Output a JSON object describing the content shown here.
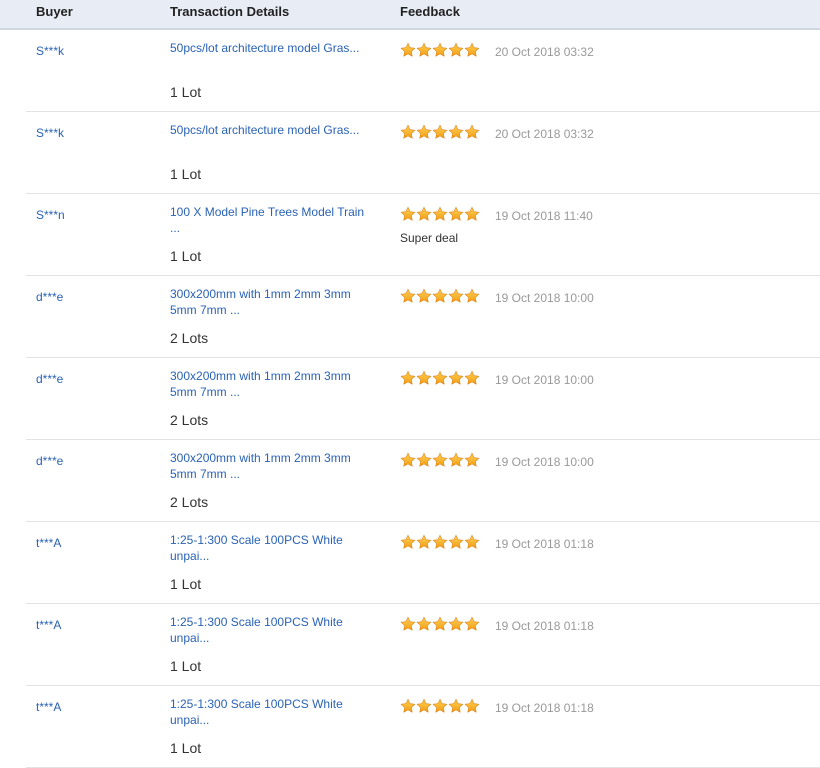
{
  "header": {
    "buyer": "Buyer",
    "transaction": "Transaction Details",
    "feedback": "Feedback"
  },
  "colors": {
    "link": "#2a62b5",
    "star": "#f39c12",
    "header_bg": "#e8edf5"
  },
  "rows": [
    {
      "buyer": "S***k",
      "product_line1": "50pcs/lot architecture model Gras...",
      "product_line2": "",
      "quantity": "1 Lot",
      "stars": 5,
      "date": "20 Oct 2018 03:32",
      "comment": ""
    },
    {
      "buyer": "S***k",
      "product_line1": "50pcs/lot architecture model Gras...",
      "product_line2": "",
      "quantity": "1 Lot",
      "stars": 5,
      "date": "20 Oct 2018 03:32",
      "comment": ""
    },
    {
      "buyer": "S***n",
      "product_line1": "100 X Model Pine Trees Model Train",
      "product_line2": "...",
      "quantity": "1 Lot",
      "stars": 5,
      "date": "19 Oct 2018 11:40",
      "comment": "Super deal"
    },
    {
      "buyer": "d***e",
      "product_line1": "300x200mm with 1mm 2mm 3mm",
      "product_line2": "5mm 7mm ...",
      "quantity": "2 Lots",
      "stars": 5,
      "date": "19 Oct 2018 10:00",
      "comment": ""
    },
    {
      "buyer": "d***e",
      "product_line1": "300x200mm with 1mm 2mm 3mm",
      "product_line2": "5mm 7mm ...",
      "quantity": "2 Lots",
      "stars": 5,
      "date": "19 Oct 2018 10:00",
      "comment": ""
    },
    {
      "buyer": "d***e",
      "product_line1": "300x200mm with 1mm 2mm 3mm",
      "product_line2": "5mm 7mm ...",
      "quantity": "2 Lots",
      "stars": 5,
      "date": "19 Oct 2018 10:00",
      "comment": ""
    },
    {
      "buyer": "t***A",
      "product_line1": "1:25-1:300 Scale 100PCS White",
      "product_line2": "unpai...",
      "quantity": "1 Lot",
      "stars": 5,
      "date": "19 Oct 2018 01:18",
      "comment": ""
    },
    {
      "buyer": "t***A",
      "product_line1": "1:25-1:300 Scale 100PCS White",
      "product_line2": "unpai...",
      "quantity": "1 Lot",
      "stars": 5,
      "date": "19 Oct 2018 01:18",
      "comment": ""
    },
    {
      "buyer": "t***A",
      "product_line1": "1:25-1:300 Scale 100PCS White",
      "product_line2": "unpai...",
      "quantity": "1 Lot",
      "stars": 5,
      "date": "19 Oct 2018 01:18",
      "comment": ""
    }
  ]
}
